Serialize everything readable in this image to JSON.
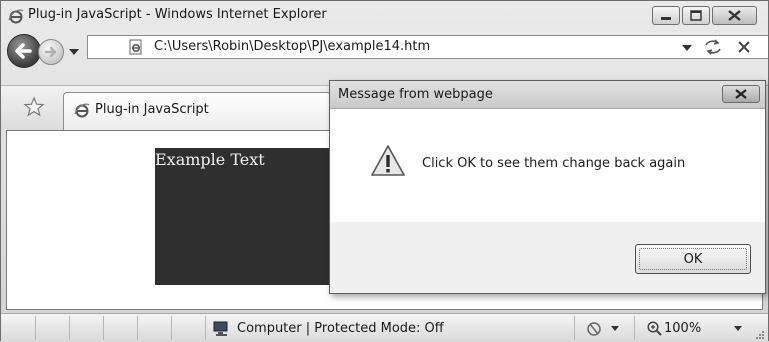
{
  "window": {
    "title": "Plug-in JavaScript - Windows Internet Explorer",
    "controls": {
      "minimize": "minimize-icon",
      "maximize": "maximize-icon",
      "close": "close-icon"
    }
  },
  "navigation": {
    "address": "C:\\Users\\Robin\\Desktop\\PJ\\example14.htm",
    "icons": [
      "back-arrow-icon",
      "forward-arrow-icon",
      "chevron-down-icon",
      "page-icon",
      "refresh-icon",
      "stop-icon"
    ]
  },
  "tabs": [
    {
      "label": "Plug-in JavaScript",
      "icon": "ie-logo-icon"
    }
  ],
  "page": {
    "example_text": "Example Text"
  },
  "dialog": {
    "title": "Message from webpage",
    "message": "Click OK to see them change back again",
    "ok_label": "OK",
    "icon": "warning-icon"
  },
  "statusbar": {
    "zone_text": "Computer | Protected Mode: Off",
    "zoom": "100%"
  }
}
